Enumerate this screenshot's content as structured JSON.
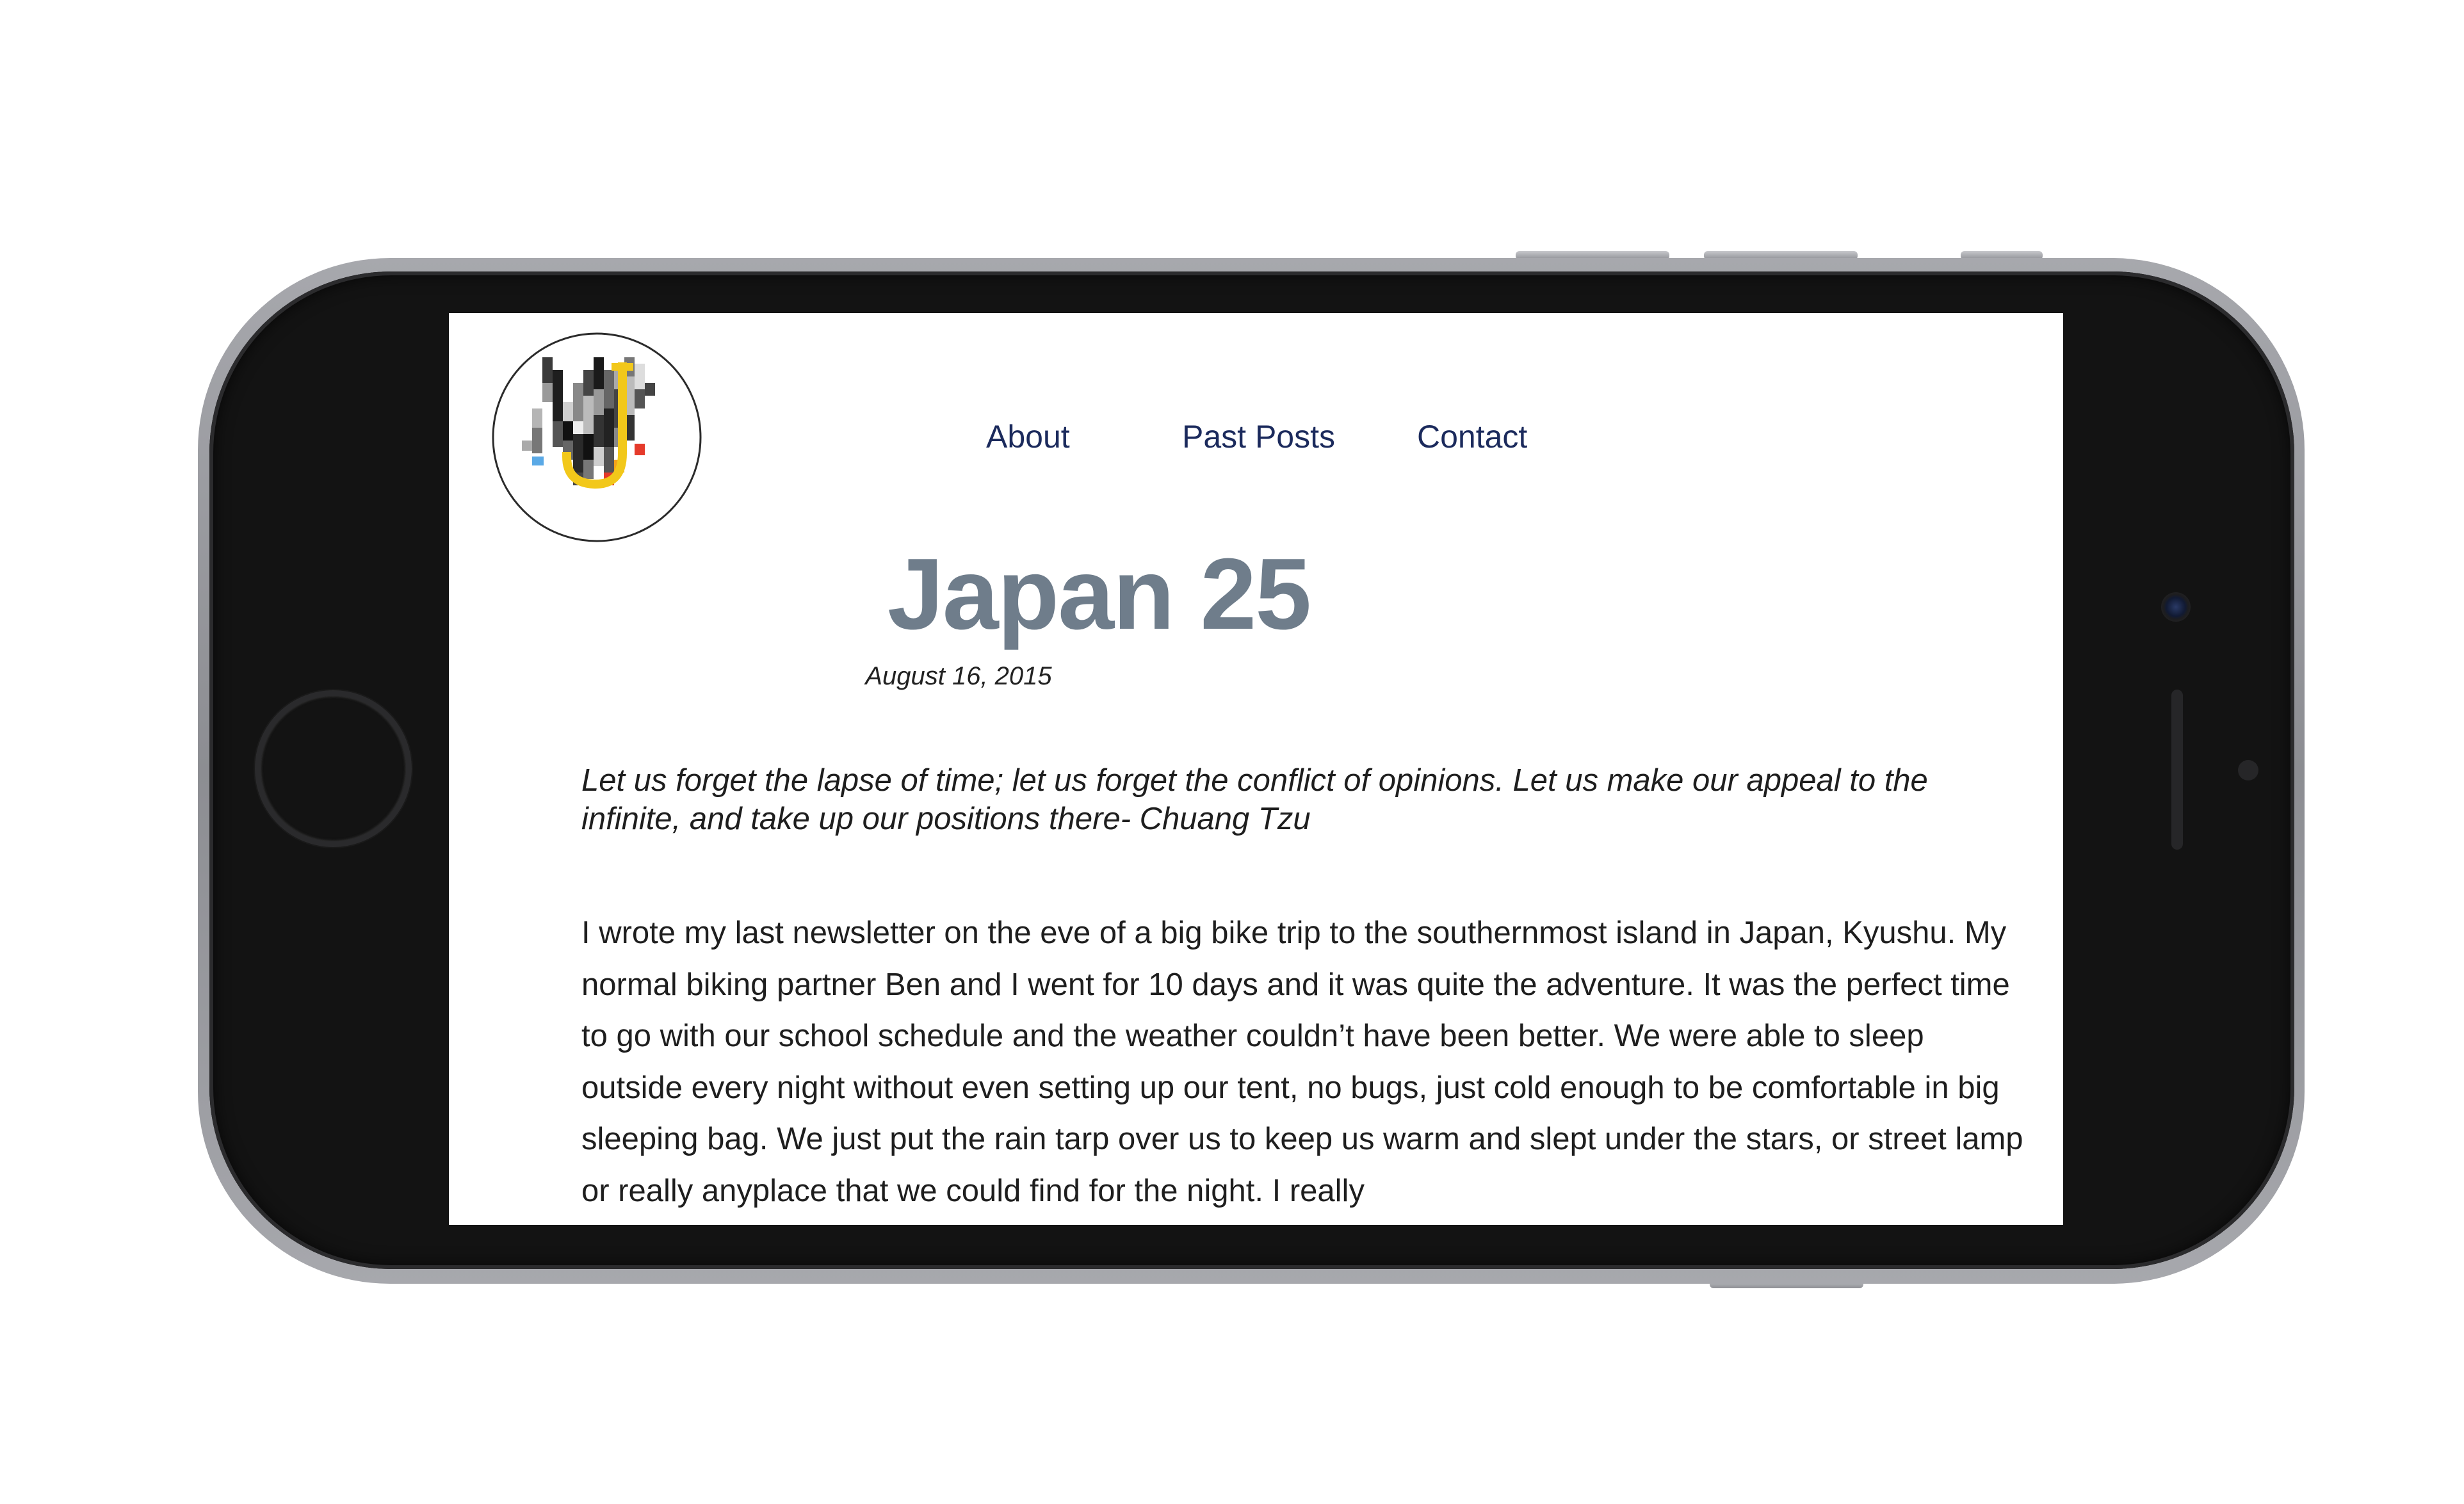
{
  "nav": {
    "about": "About",
    "past_posts": "Past Posts",
    "contact": "Contact"
  },
  "post": {
    "title": "Japan 25",
    "date": "August 16, 2015",
    "quote": "Let us forget the lapse of time; let us forget the conflict of opinions. Let us make our appeal to the infinite, and take up our positions there- Chuang Tzu",
    "body": "I wrote my last newsletter on the eve of a big bike trip to the southernmost island in Japan, Kyushu. My normal biking partner Ben and I went for 10 days and it was quite the adventure. It was the perfect time to go with our school schedule and the weather couldn’t have been better. We were able to sleep outside every night without even setting up our tent, no bugs, just cold enough to be comfortable in big sleeping bag. We just put the rain tarp over us to keep us warm and slept under the stars, or street lamp or really anyplace that we could find for the night. I really"
  },
  "colors": {
    "nav_link": "#1b2a5c",
    "title": "#6f7d8b",
    "logo_yellow": "#f2c81a",
    "logo_red": "#e53a2b",
    "logo_blue": "#5aa9e6"
  },
  "icons": {
    "logo": "pixelated-j-logo",
    "home_button": "home-button",
    "camera": "front-camera"
  }
}
